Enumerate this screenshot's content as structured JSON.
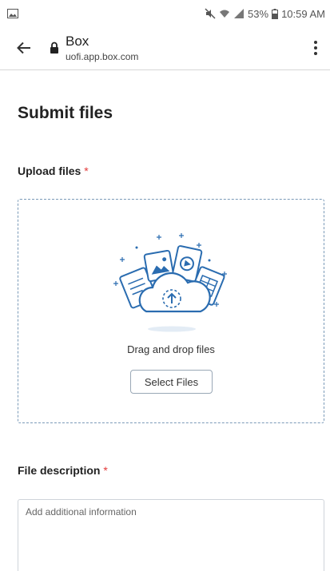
{
  "status_bar": {
    "battery": "53%",
    "time": "10:59 AM"
  },
  "browser": {
    "site_title": "Box",
    "url": "uofi.app.box.com"
  },
  "form": {
    "title": "Submit files",
    "upload_label": "Upload files",
    "required_marker": "*",
    "drag_text": "Drag and drop files",
    "select_button": "Select Files",
    "description_label": "File description",
    "description_placeholder": "Add additional information"
  },
  "colors": {
    "accent": "#2a6cb0",
    "required": "#e33a3a"
  }
}
